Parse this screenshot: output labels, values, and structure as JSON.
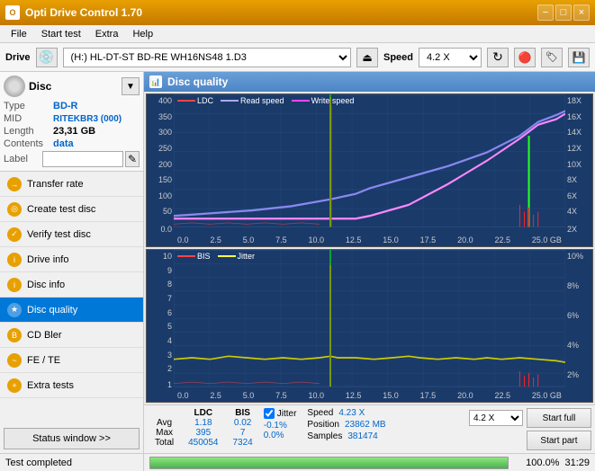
{
  "titlebar": {
    "title": "Opti Drive Control 1.70",
    "minimize": "−",
    "maximize": "□",
    "close": "×"
  },
  "menubar": {
    "items": [
      "File",
      "Start test",
      "Extra",
      "Help"
    ]
  },
  "drivebar": {
    "label": "Drive",
    "drive_value": "(H:)  HL-DT-ST BD-RE  WH16NS48 1.D3",
    "speed_label": "Speed",
    "speed_value": "4.2 X"
  },
  "disc": {
    "title": "Disc",
    "type_label": "Type",
    "type_value": "BD-R",
    "mid_label": "MID",
    "mid_value": "RITEKBR3 (000)",
    "length_label": "Length",
    "length_value": "23,31 GB",
    "contents_label": "Contents",
    "contents_value": "data",
    "label_label": "Label",
    "label_value": ""
  },
  "nav": {
    "items": [
      {
        "id": "transfer-rate",
        "label": "Transfer rate",
        "icon": "→"
      },
      {
        "id": "create-test-disc",
        "label": "Create test disc",
        "icon": "◎"
      },
      {
        "id": "verify-test-disc",
        "label": "Verify test disc",
        "icon": "✓"
      },
      {
        "id": "drive-info",
        "label": "Drive info",
        "icon": "i"
      },
      {
        "id": "disc-info",
        "label": "Disc info",
        "icon": "i"
      },
      {
        "id": "disc-quality",
        "label": "Disc quality",
        "icon": "★",
        "active": true
      },
      {
        "id": "cd-bler",
        "label": "CD Bler",
        "icon": "B"
      },
      {
        "id": "fe-te",
        "label": "FE / TE",
        "icon": "~"
      },
      {
        "id": "extra-tests",
        "label": "Extra tests",
        "icon": "+"
      }
    ]
  },
  "status_window_btn": "Status window >>",
  "chart": {
    "title": "Disc quality",
    "top": {
      "legend": [
        {
          "label": "LDC",
          "color": "#ff4444"
        },
        {
          "label": "Read speed",
          "color": "#aaaaff"
        },
        {
          "label": "Write speed",
          "color": "#ff44ff"
        }
      ],
      "y_left": [
        "400",
        "350",
        "300",
        "250",
        "200",
        "150",
        "100",
        "50",
        "0.0"
      ],
      "y_right": [
        "18X",
        "16X",
        "14X",
        "12X",
        "10X",
        "8X",
        "6X",
        "4X",
        "2X"
      ],
      "x_labels": [
        "0.0",
        "2.5",
        "5.0",
        "7.5",
        "10.0",
        "12.5",
        "15.0",
        "17.5",
        "20.0",
        "22.5",
        "25.0 GB"
      ]
    },
    "bottom": {
      "legend": [
        {
          "label": "BIS",
          "color": "#ff4444"
        },
        {
          "label": "Jitter",
          "color": "#ffff44"
        }
      ],
      "y_left": [
        "10",
        "9",
        "8",
        "7",
        "6",
        "5",
        "4",
        "3",
        "2",
        "1"
      ],
      "y_right": [
        "10%",
        "8%",
        "6%",
        "4%",
        "2%"
      ],
      "x_labels": [
        "0.0",
        "2.5",
        "5.0",
        "7.5",
        "10.0",
        "12.5",
        "15.0",
        "17.5",
        "20.0",
        "22.5",
        "25.0 GB"
      ]
    }
  },
  "stats": {
    "headers": [
      "LDC",
      "BIS"
    ],
    "jitter_label": "Jitter",
    "rows": [
      {
        "label": "Avg",
        "ldc": "1.18",
        "bis": "0.02",
        "jitter": "-0.1%"
      },
      {
        "label": "Max",
        "ldc": "395",
        "bis": "7",
        "jitter": "0.0%"
      },
      {
        "label": "Total",
        "ldc": "450054",
        "bis": "7324",
        "jitter": ""
      }
    ],
    "speed_label": "Speed",
    "speed_value": "4.23 X",
    "position_label": "Position",
    "position_value": "23862 MB",
    "samples_label": "Samples",
    "samples_value": "381474",
    "speed_select": "4.2 X",
    "start_full_btn": "Start full",
    "start_part_btn": "Start part"
  },
  "bottombar": {
    "status": "Test completed",
    "progress": 100,
    "progress_text": "100.0%",
    "time": "31:29"
  }
}
